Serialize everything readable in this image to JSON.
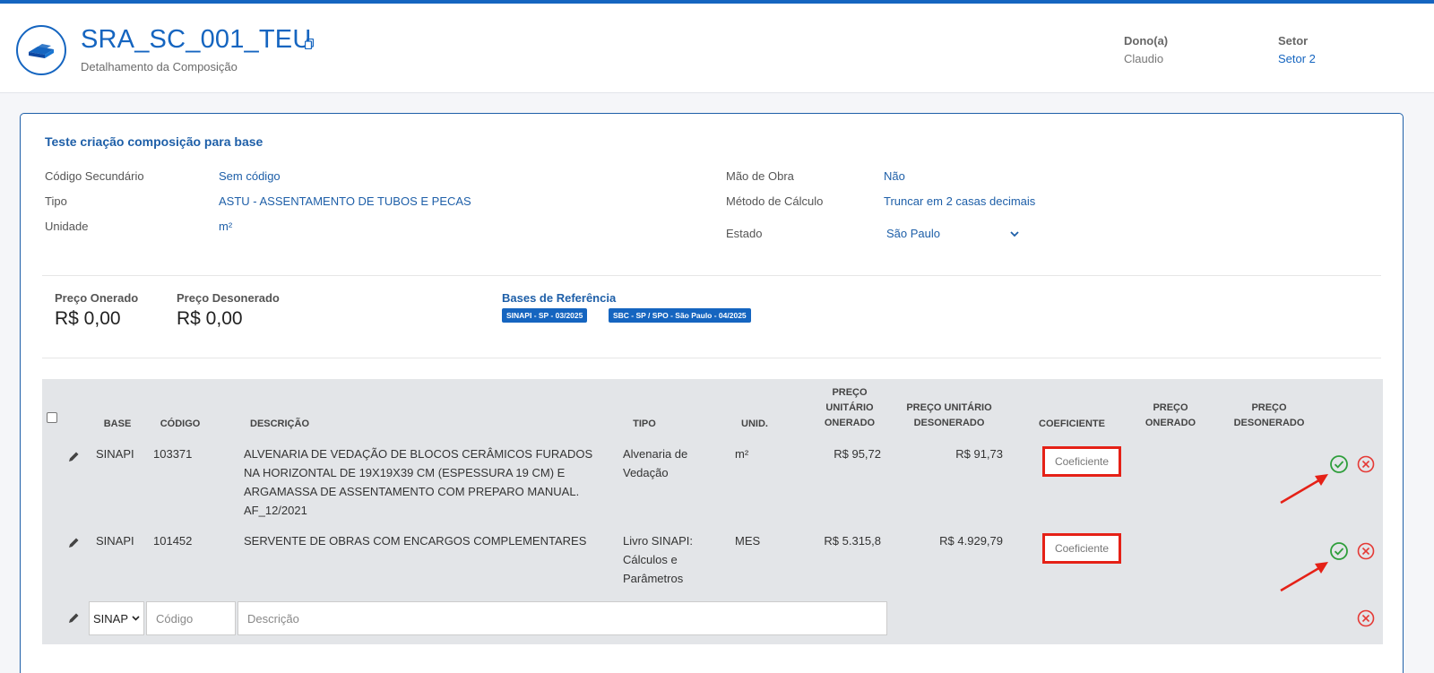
{
  "header": {
    "title": "SRA_SC_001_TEU",
    "subtitle": "Detalhamento da Composição",
    "owner_label": "Dono(a)",
    "owner_value": "Claudio",
    "sector_label": "Setor",
    "sector_value": "Setor 2"
  },
  "card": {
    "title": "Teste criação composição para base",
    "fields_left": [
      {
        "label": "Código Secundário",
        "value": "Sem código"
      },
      {
        "label": "Tipo",
        "value": "ASTU - ASSENTAMENTO DE TUBOS E PECAS"
      },
      {
        "label": "Unidade",
        "value": "m²"
      }
    ],
    "fields_right": [
      {
        "label": "Mão de Obra",
        "value": "Não"
      },
      {
        "label": "Método de Cálculo",
        "value": "Truncar em 2 casas decimais"
      }
    ],
    "estado": {
      "label": "Estado",
      "value": "São Paulo"
    },
    "preco_onerado": {
      "label": "Preço Onerado",
      "value": "R$ 0,00"
    },
    "preco_desonerado": {
      "label": "Preço Desonerado",
      "value": "R$ 0,00"
    },
    "bases": {
      "title": "Bases de Referência",
      "tags": [
        "SINAPI - SP - 03/2025",
        "SBC - SP / SPO - São Paulo - 04/2025"
      ]
    }
  },
  "table": {
    "headers": {
      "base": "BASE",
      "codigo": "CÓDIGO",
      "descricao": "DESCRIÇÃO",
      "tipo": "TIPO",
      "unid": "UNID.",
      "pu_onerado": "PREÇO UNITÁRIO ONERADO",
      "pu_desonerado": "PREÇO UNITÁRIO DESONERADO",
      "coeficiente": "COEFICIENTE",
      "preco_onerado": "PREÇO ONERADO",
      "preco_desonerado": "PREÇO DESONERADO"
    },
    "rows": [
      {
        "base": "SINAPI",
        "codigo": "103371",
        "descricao": "ALVENARIA DE VEDAÇÃO DE BLOCOS CERÂMICOS FURADOS NA HORIZONTAL DE 19X19X39 CM (ESPESSURA 19 CM) E ARGAMASSA DE ASSENTAMENTO COM PREPARO MANUAL. AF_12/2021",
        "tipo": "Alvenaria de Vedação",
        "unid": "m²",
        "pu_onerado": "R$ 95,72",
        "pu_desonerado": "R$ 91,73",
        "coef_placeholder": "Coeficiente"
      },
      {
        "base": "SINAPI",
        "codigo": "101452",
        "descricao": "SERVENTE DE OBRAS COM ENCARGOS COMPLEMENTARES",
        "tipo": "Livro SINAPI: Cálculos e Parâmetros",
        "unid": "MES",
        "pu_onerado": "R$ 5.315,8",
        "pu_desonerado": "R$ 4.929,79",
        "coef_placeholder": "Coeficiente"
      }
    ],
    "new_row": {
      "base_selected": "SINAP",
      "codigo_placeholder": "Código",
      "descricao_placeholder": "Descrição"
    }
  },
  "colors": {
    "accent": "#1565c0",
    "confirm": "#2e9e3b",
    "remove": "#e53935",
    "annotation": "#e52117"
  }
}
